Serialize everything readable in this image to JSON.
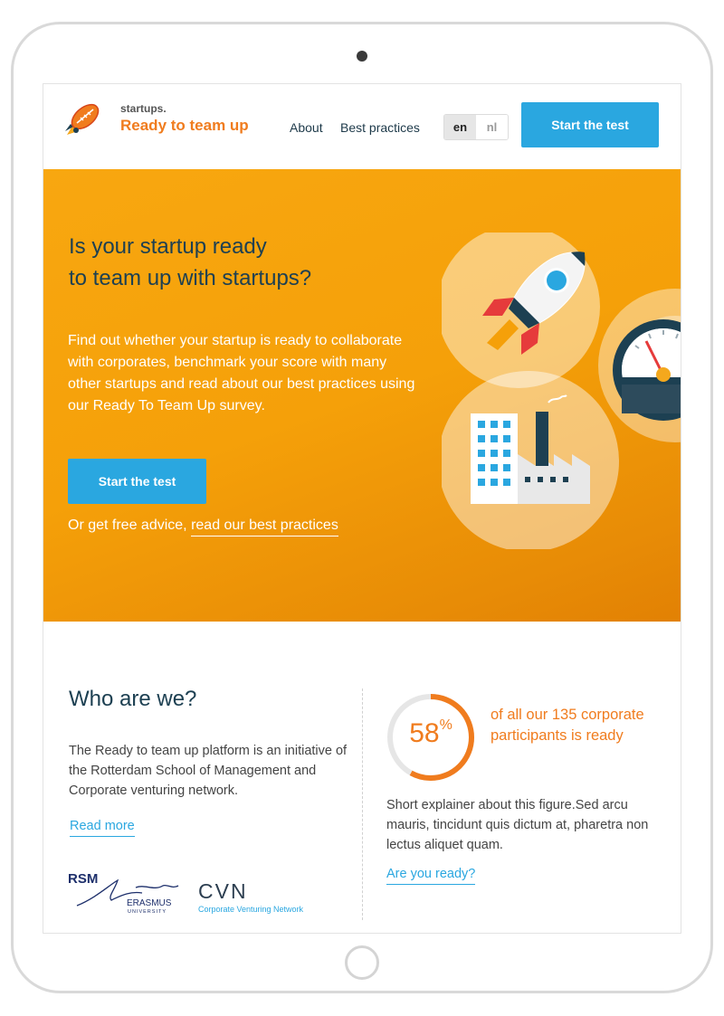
{
  "header": {
    "brand_small": "startups.",
    "brand_title": "Ready to team up",
    "nav": {
      "about": "About",
      "best_practices": "Best practices"
    },
    "languages": {
      "active": "en",
      "other": "nl"
    },
    "cta_label": "Start the test"
  },
  "hero": {
    "title_line1": "Is your startup ready",
    "title_line2": "to team up with startups?",
    "description": "Find out whether your startup is ready to collaborate with corporates, benchmark your score with many other startups and read about our best practices using our Ready To Team Up survey.",
    "cta_label": "Start the test",
    "advice_prefix": "Or get free advice, ",
    "advice_link": "read our best practices"
  },
  "who": {
    "title": "Who are we?",
    "text": "The Ready to team up platform is an initiative of the Rotterdam School of Management and Corporate venturing network.",
    "read_more": "Read more",
    "partner_logos": {
      "rsm": {
        "acronym": "RSM",
        "script": "Erasmus",
        "name": "ERASMUS",
        "sub": "UNIVERSITY"
      },
      "cvn": {
        "acronym": "CVN",
        "name": "Corporate Venturing Network"
      }
    }
  },
  "stat": {
    "value": "58",
    "unit": "%",
    "fraction": 0.58,
    "caption": "of all our 135 corporate participants is ready",
    "explainer": "Short explainer about this figure.Sed arcu mauris, tincidunt quis dictum at, pharetra non lectus aliquet quam.",
    "link": "Are you ready?"
  },
  "colors": {
    "accent_orange": "#f07c1e",
    "hero_orange": "#f5a009",
    "button_blue": "#2aa7e0",
    "heading_navy": "#1d4052"
  },
  "icons": [
    "rocket-ball-logo-icon",
    "rocket-icon",
    "speedometer-icon",
    "factory-icon"
  ]
}
